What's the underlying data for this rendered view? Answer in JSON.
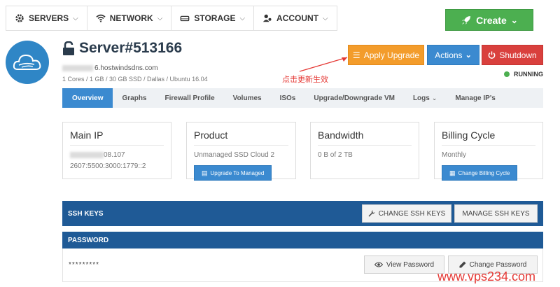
{
  "nav": {
    "items": [
      {
        "label": "SERVERS",
        "icon": "servers-cog-icon"
      },
      {
        "label": "NETWORK",
        "icon": "wifi-icon"
      },
      {
        "label": "STORAGE",
        "icon": "storage-drive-icon"
      },
      {
        "label": "ACCOUNT",
        "icon": "account-users-icon"
      }
    ],
    "create_label": "Create"
  },
  "server": {
    "title": "Server#513166",
    "hostname_suffix": "6.hostwindsdns.com",
    "specs": "1 Cores / 1 GB / 30 GB SSD / Dallas / Ubuntu 16.04",
    "status": "RUNNING"
  },
  "header_buttons": {
    "apply_upgrade": "Apply Upgrade",
    "actions": "Actions",
    "shutdown": "Shutdown"
  },
  "annotation": {
    "text": "点击更新生效"
  },
  "tabs": [
    {
      "label": "Overview",
      "active": true
    },
    {
      "label": "Graphs"
    },
    {
      "label": "Firewall Profile"
    },
    {
      "label": "Volumes"
    },
    {
      "label": "ISOs"
    },
    {
      "label": "Upgrade/Downgrade VM"
    },
    {
      "label": "Logs"
    },
    {
      "label": "Manage IP's"
    }
  ],
  "cards": {
    "main_ip": {
      "title": "Main IP",
      "ipv4_suffix": "08.107",
      "ipv6": "2607:5500:3000:1779::2"
    },
    "product": {
      "title": "Product",
      "value": "Unmanaged SSD Cloud 2",
      "button": "Upgrade To Managed"
    },
    "bandwidth": {
      "title": "Bandwidth",
      "value": "0 B of 2 TB"
    },
    "billing": {
      "title": "Billing Cycle",
      "value": "Monthly",
      "button": "Change Billing Cycle"
    }
  },
  "ssh": {
    "label": "SSH KEYS",
    "change_button": "CHANGE SSH KEYS",
    "manage_button": "MANAGE SSH KEYS"
  },
  "password": {
    "label": "PASSWORD",
    "masked": "*********",
    "view_button": "View Password",
    "change_button": "Change Password"
  },
  "watermark": "www.vps234.com",
  "colors": {
    "primary_blue": "#3b8ad0",
    "dark_blue": "#1f5a96",
    "create_green": "#4caf50",
    "apply_orange": "#f39c2b",
    "shutdown_red": "#d9403d",
    "annotation_red": "#e53935"
  }
}
